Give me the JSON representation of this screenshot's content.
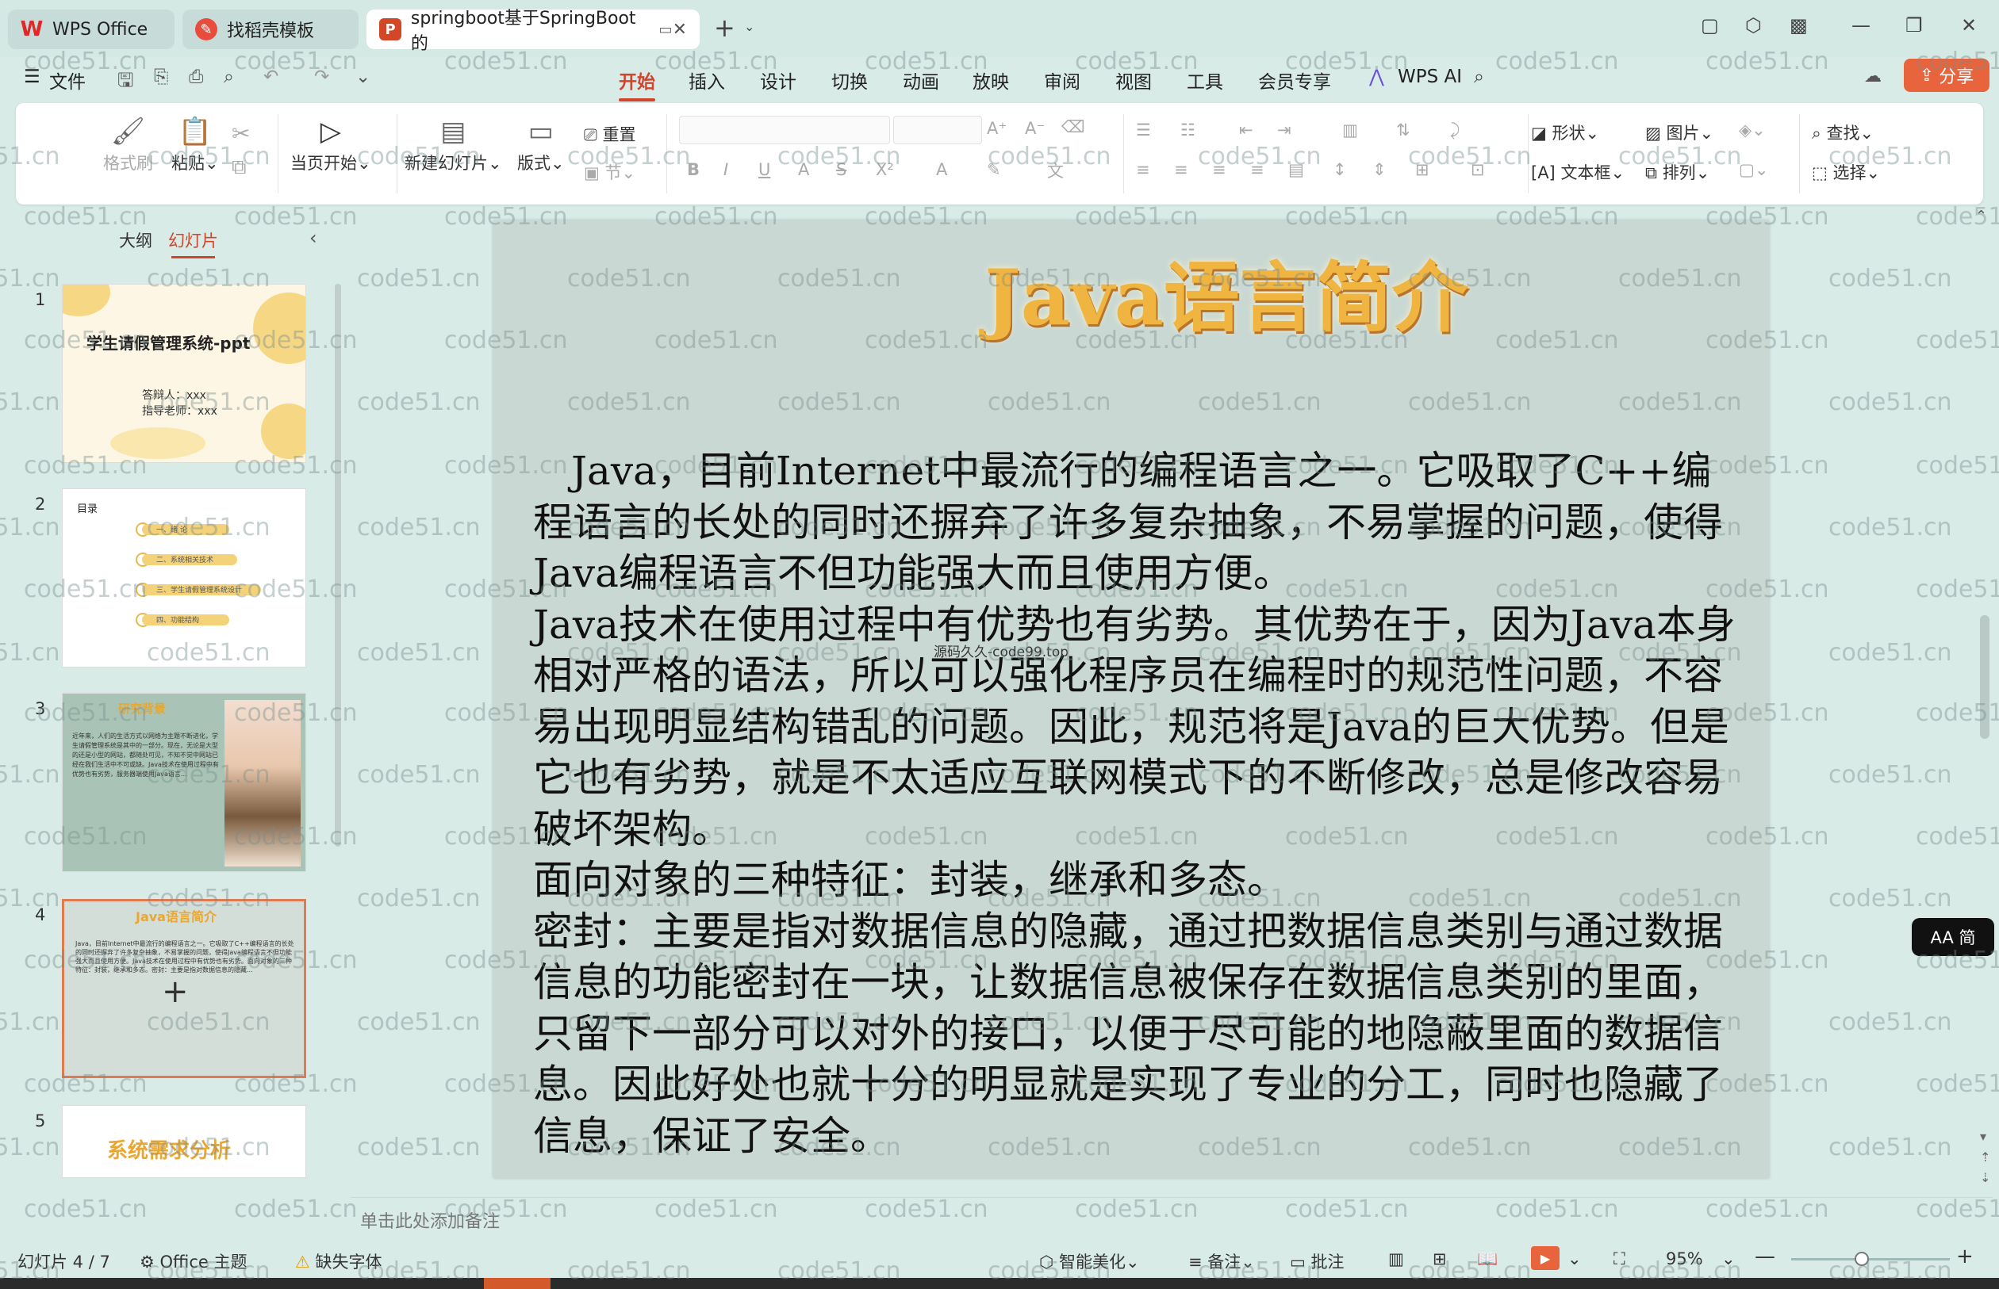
{
  "tabs": [
    {
      "label": "WPS Office"
    },
    {
      "label": "找稻壳模板"
    },
    {
      "label": "springboot基于SpringBoot的"
    }
  ],
  "menu": {
    "file": "文件",
    "items": [
      "开始",
      "插入",
      "设计",
      "切换",
      "动画",
      "放映",
      "审阅",
      "视图",
      "工具",
      "会员专享"
    ],
    "active": "开始",
    "wps_ai": "WPS AI",
    "share": "分享"
  },
  "ribbon": {
    "format_painter": "格式刷",
    "paste": "粘贴",
    "play_current": "当页开始",
    "new_slide": "新建幻灯片",
    "layout": "版式",
    "reset": "重置",
    "section": "节",
    "shape": "形状",
    "picture": "图片",
    "find": "查找",
    "textbox": "文本框",
    "arrange": "排列",
    "select": "选择"
  },
  "left_panel": {
    "tab_outline": "大纲",
    "tab_slides": "幻灯片",
    "slide_numbers": [
      "1",
      "2",
      "3",
      "4",
      "5"
    ],
    "thumb1_title": "学生请假管理系统-ppt",
    "thumb1_sub1": "答辩人：xxx",
    "thumb1_sub2": "指导老师：xxx",
    "thumb2_header": "目录",
    "thumb2_items": [
      "一、绪 论",
      "二、系统相关技术",
      "三、学生请假管理系统设计",
      "四、功能结构"
    ],
    "thumb3_title": "研究背景",
    "thumb3_text": "近年来，人们的生活方式以网络为主题不断进化，学生请假管理系统是其中的一部分。现在，无论是大型的还是小型的网站，都随处可见，不知不觉中网站已经在我们生活中不可或缺。Java技术在使用过程中有优势也有劣势，服务器端使用Java语言...",
    "thumb4_title": "Java语言简介",
    "thumb4_text": "Java，目前Internet中最流行的编程语言之一。它吸取了C++编程语言的长处的同时还摒弃了许多复杂抽象，不易掌握的问题，使得Java编程语言不但功能强大而且使用方便。Java技术在使用过程中有优势也有劣势。面向对象的三种特征：封装，继承和多态。密封：主要是指对数据信息的隐藏...",
    "thumb5_title": "系统需求分析"
  },
  "slide": {
    "title": "Java语言简介",
    "paragraphs": [
      "Java，目前Internet中最流行的编程语言之一。它吸取了C++编程语言的长处的同时还摒弃了许多复杂抽象，不易掌握的问题，使得Java编程语言不但功能强大而且使用方便。",
      "Java技术在使用过程中有优势也有劣势。其优势在于，因为Java本身相对严格的语法，所以可以强化程序员在编程时的规范性问题，不容易出现明显结构错乱的问题。因此，规范将是Java的巨大优势。但是它也有劣势，就是不太适应互联网模式下的不断修改，总是修改容易破坏架构。",
      "面向对象的三种特征：封装，继承和多态。",
      "密封：主要是指对数据信息的隐藏，通过把数据信息类别与通过数据信息的功能密封在一块，让数据信息被保存在数据信息类别的里面，只留下一部分可以对外的接口，以便于尽可能的地隐蔽里面的数据信息。因此好处也就十分的明显就是实现了专业的分工，同时也隐藏了信息，保证了安全。"
    ],
    "inner_watermark": "源码久久-code99.top"
  },
  "notes_placeholder": "单击此处添加备注",
  "aa_button": "AA 简",
  "status": {
    "slide_counter": "幻灯片 4 / 7",
    "theme": "Office 主题",
    "missing_font": "缺失字体",
    "beautify": "智能美化",
    "notes": "备注",
    "comments": "批注",
    "zoom": "95%"
  },
  "watermark_text": "code51.cn",
  "colors": {
    "accent": "#d2442c",
    "share": "#e8643c",
    "slide_bg": "#cad8d3",
    "title": "#f0b440"
  }
}
